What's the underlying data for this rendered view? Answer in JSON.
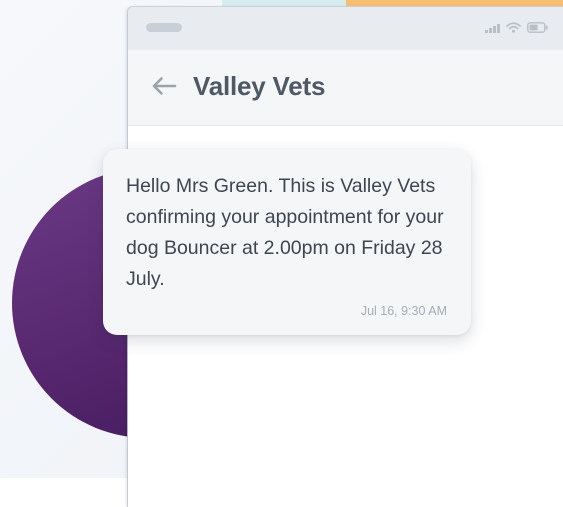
{
  "header": {
    "title": "Valley Vets",
    "back_icon": "arrow-left-icon"
  },
  "status_bar": {
    "icons": [
      "signal-icon",
      "wifi-icon",
      "battery-icon"
    ]
  },
  "message": {
    "text": "Hello Mrs Green. This is Valley Vets confirming your appointment for your dog Bouncer at 2.00pm on Friday 28 July.",
    "timestamp": "Jul 16, 9:30 AM"
  },
  "colors": {
    "accent_purple": "#57276f",
    "accent_orange": "#f7bd73",
    "accent_teal": "#d6ecee",
    "title_text": "#4f5965",
    "bubble_background": "#f4f6f8"
  }
}
